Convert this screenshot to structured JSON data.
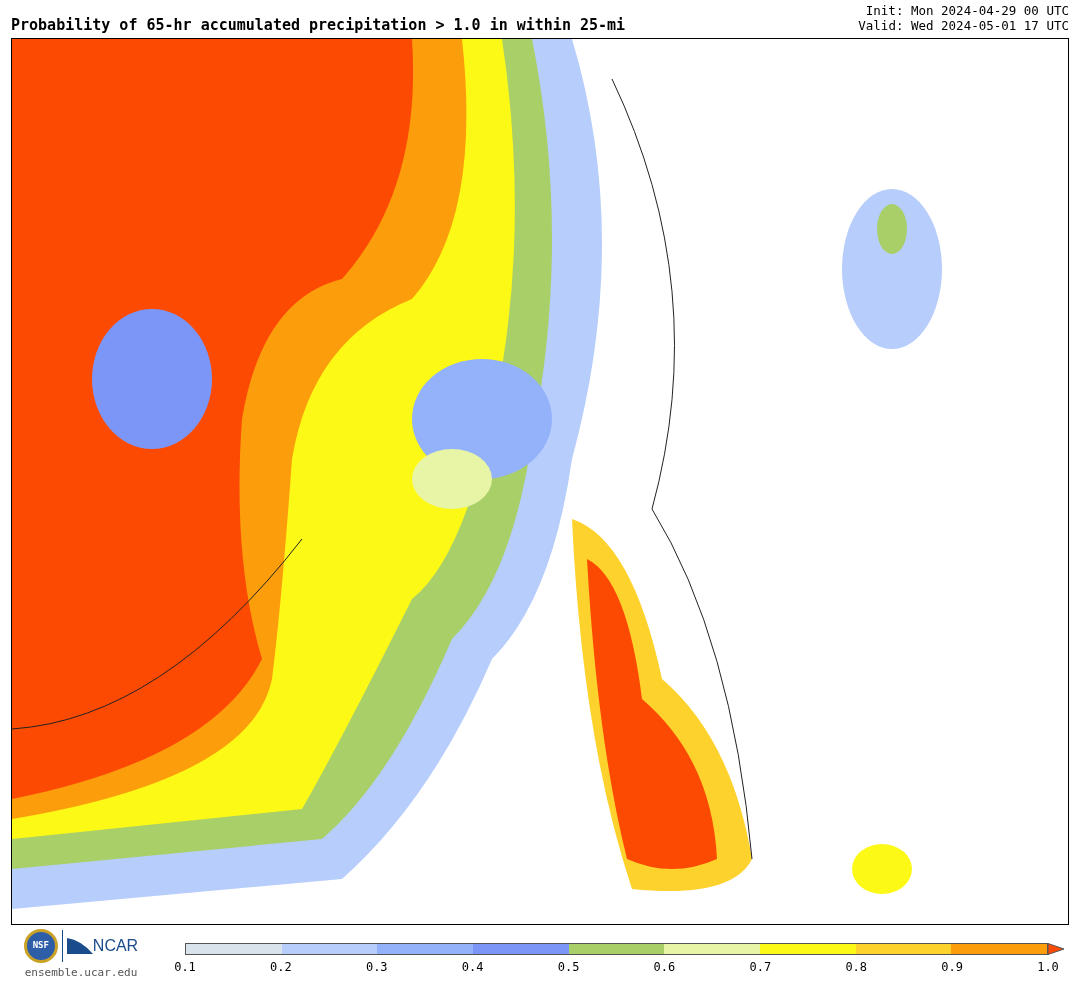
{
  "title": "Probability of 65-hr accumulated precipitation > 1.0 in within 25-mi",
  "init": "Init: Mon 2024-04-29 00 UTC",
  "valid": "Valid: Wed 2024-05-01 17 UTC",
  "logo": {
    "nsf": "NSF",
    "ncar": "NCAR",
    "url": "ensemble.ucar.edu"
  },
  "colorbar": {
    "bins": [
      {
        "kind": "band",
        "color": "#d8e3ec"
      },
      {
        "kind": "band",
        "color": "#b7cdfb"
      },
      {
        "kind": "band",
        "color": "#93b2fa"
      },
      {
        "kind": "band",
        "color": "#7c96f7"
      },
      {
        "kind": "band",
        "color": "#a9cf69"
      },
      {
        "kind": "band",
        "color": "#e8f5a6"
      },
      {
        "kind": "band",
        "color": "#fdf916"
      },
      {
        "kind": "band",
        "color": "#fdd22c"
      },
      {
        "kind": "band",
        "color": "#fc9e0c"
      },
      {
        "kind": "arrow",
        "color": "#fd4a03"
      }
    ],
    "ticks": [
      "0.1",
      "0.2",
      "0.3",
      "0.4",
      "0.5",
      "0.6",
      "0.7",
      "0.8",
      "0.9",
      "1.0"
    ]
  }
}
